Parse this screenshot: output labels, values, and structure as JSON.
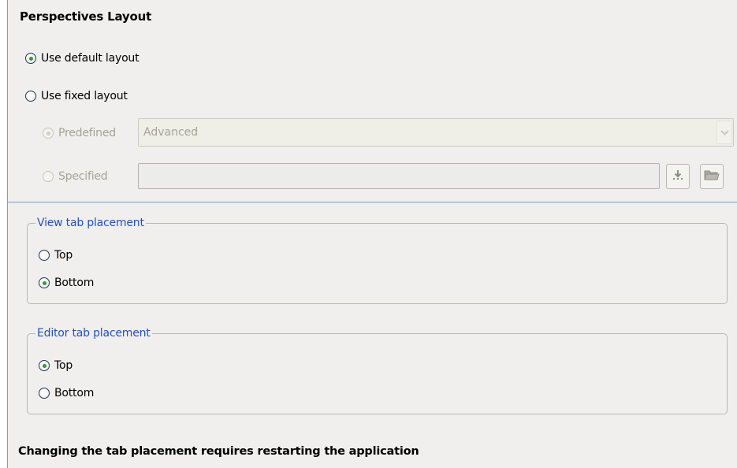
{
  "page": {
    "title": "Perspectives Layout",
    "footer_note": "Changing the tab placement requires restarting the application"
  },
  "layout_mode": {
    "default_option": {
      "label": "Use default layout",
      "checked": true
    },
    "fixed_option": {
      "label": "Use fixed layout",
      "checked": false
    },
    "predefined": {
      "label": "Predefined",
      "checked": true,
      "enabled": false,
      "selected_value": "Advanced"
    },
    "specified": {
      "label": "Specified",
      "checked": false,
      "enabled": false,
      "value": ""
    }
  },
  "view_tab_placement": {
    "legend": "View tab placement",
    "options": [
      {
        "label": "Top",
        "checked": false
      },
      {
        "label": "Bottom",
        "checked": true
      }
    ]
  },
  "editor_tab_placement": {
    "legend": "Editor tab placement",
    "options": [
      {
        "label": "Top",
        "checked": true
      },
      {
        "label": "Bottom",
        "checked": false
      }
    ]
  },
  "icons": {
    "download": "download-icon",
    "folder": "folder-icon",
    "dropdown": "chevron-down-icon"
  },
  "colors": {
    "group_legend": "#1f4fd0",
    "separator": "#7d9bc4",
    "radio_checked": "#2e9a35"
  }
}
